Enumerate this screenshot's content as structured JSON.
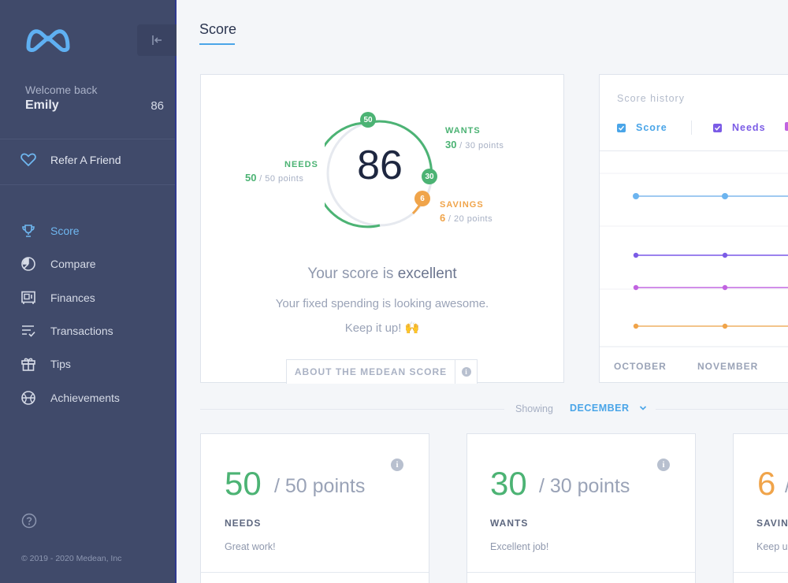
{
  "sidebar": {
    "welcome": "Welcome back",
    "user_name": "Emily",
    "user_score": "86",
    "refer": "Refer A Friend",
    "nav": [
      {
        "label": "Score",
        "icon": "trophy-icon",
        "active": true
      },
      {
        "label": "Compare",
        "icon": "pie-chart-icon",
        "active": false
      },
      {
        "label": "Finances",
        "icon": "safe-icon",
        "active": false
      },
      {
        "label": "Transactions",
        "icon": "list-check-icon",
        "active": false
      },
      {
        "label": "Tips",
        "icon": "gift-icon",
        "active": false
      },
      {
        "label": "Achievements",
        "icon": "medal-icon",
        "active": false
      }
    ],
    "copyright": "© 2019 - 2020 Medean, Inc"
  },
  "page": {
    "title": "Score"
  },
  "score_card": {
    "score": "86",
    "needs": {
      "title": "NEEDS",
      "value": "50",
      "of": "/ 50 points",
      "badge": "50"
    },
    "wants": {
      "title": "WANTS",
      "value": "30",
      "of": "/ 30 points",
      "badge": "30"
    },
    "savings": {
      "title": "SAVINGS",
      "value": "6",
      "of": "/ 20 points",
      "badge": "6"
    },
    "headline_prefix": "Your score is ",
    "headline_strong": "excellent",
    "message_line1": "Your fixed spending is looking awesome.",
    "message_line2": "Keep it up! 🙌",
    "about_button": "ABOUT THE MEDEAN SCORE"
  },
  "history": {
    "title": "Score history",
    "legend": [
      {
        "label": "Score",
        "color": "#4aa5e8"
      },
      {
        "label": "Needs",
        "color": "#7b5ce6"
      }
    ],
    "months": [
      "OCTOBER",
      "NOVEMBER"
    ]
  },
  "showing": {
    "label": "Showing",
    "month": "DECEMBER"
  },
  "metrics": [
    {
      "value": "50",
      "of": "/ 50 points",
      "name": "NEEDS",
      "note": "Great work!",
      "color": "#4cb374"
    },
    {
      "value": "30",
      "of": "/ 30 points",
      "name": "WANTS",
      "note": "Excellent job!",
      "color": "#4cb374"
    },
    {
      "value": "6",
      "of": "/",
      "name": "SAVIN",
      "note": "Keep u",
      "color": "#f0a44a"
    }
  ],
  "colors": {
    "sidebar": "#404a6a",
    "accent": "#4aa5e8",
    "green": "#4cb374",
    "orange": "#f0a44a",
    "purple": "#7b5ce6",
    "magenta": "#c163e0"
  }
}
